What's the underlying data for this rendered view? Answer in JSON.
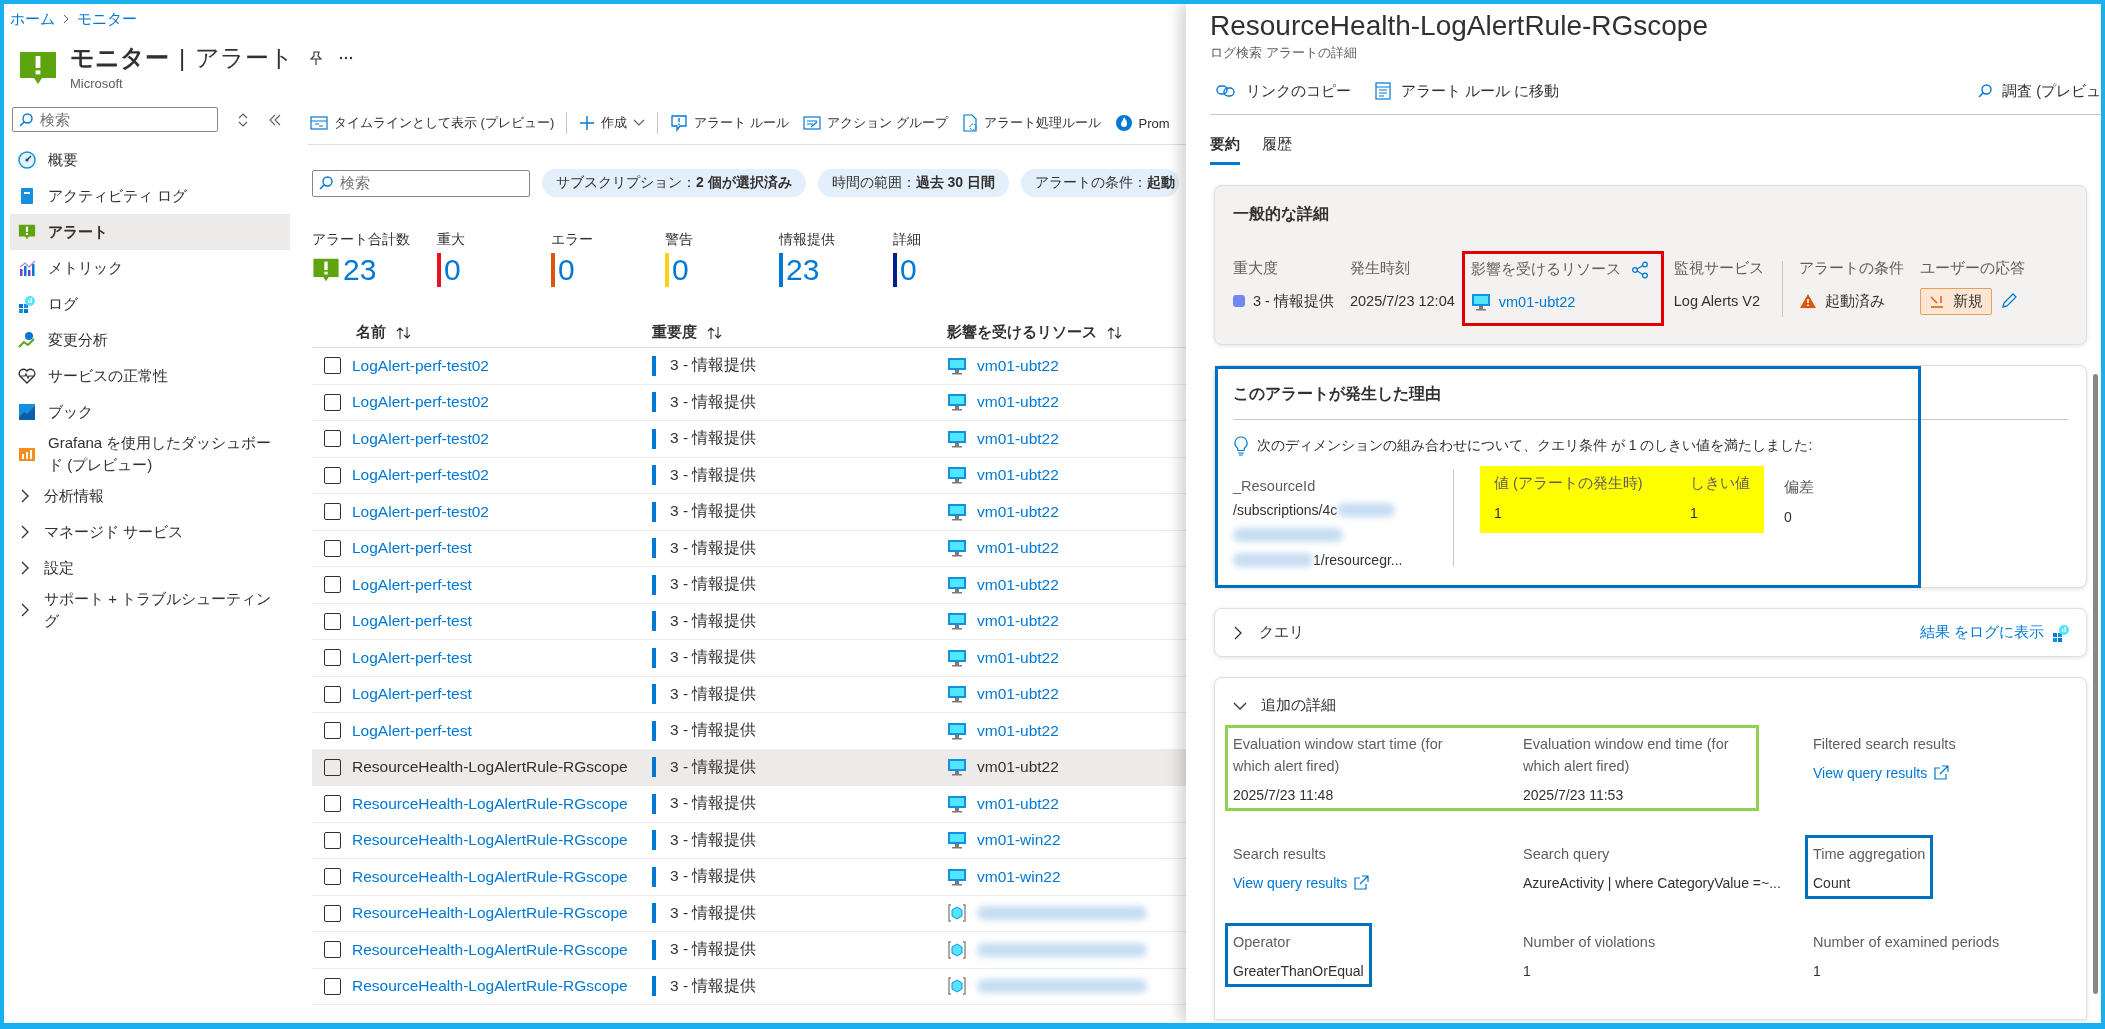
{
  "breadcrumb": [
    {
      "label": "ホーム"
    },
    {
      "label": "モニター"
    }
  ],
  "page": {
    "title": "モニター",
    "separator": "|",
    "section": "アラート",
    "subtitle": "Microsoft"
  },
  "sidebar": {
    "search": {
      "placeholder": "検索"
    },
    "items": [
      {
        "label": "概要",
        "kind": "link",
        "selected": false
      },
      {
        "label": "アクティビティ ログ",
        "kind": "link",
        "selected": false
      },
      {
        "label": "アラート",
        "kind": "link",
        "selected": true
      },
      {
        "label": "メトリック",
        "kind": "link",
        "selected": false
      },
      {
        "label": "ログ",
        "kind": "link",
        "selected": false
      },
      {
        "label": "変更分析",
        "kind": "link",
        "selected": false
      },
      {
        "label": "サービスの正常性",
        "kind": "link",
        "selected": false
      },
      {
        "label": "ブック",
        "kind": "link",
        "selected": false
      },
      {
        "label": "Grafana を使用したダッシュボード (プレビュー)",
        "kind": "link",
        "selected": false
      },
      {
        "label": "分析情報",
        "kind": "group",
        "selected": false,
        "expanded": false
      },
      {
        "label": "マネージド サービス",
        "kind": "group",
        "selected": false,
        "expanded": false
      },
      {
        "label": "設定",
        "kind": "group",
        "selected": false,
        "expanded": false
      },
      {
        "label": "サポート + トラブルシューティング",
        "kind": "group",
        "selected": false,
        "expanded": false
      }
    ]
  },
  "toolbar": [
    {
      "label": "タイムラインとして表示 (プレビュー)",
      "kind": "button"
    },
    {
      "label": "作成",
      "kind": "dropdown"
    },
    {
      "label": "アラート ルール",
      "kind": "button"
    },
    {
      "label": "アクション グループ",
      "kind": "button"
    },
    {
      "label": "アラート処理ルール",
      "kind": "button"
    },
    {
      "label": "Prom",
      "kind": "button"
    }
  ],
  "filters": {
    "search": {
      "placeholder": "検索"
    },
    "pills": [
      {
        "label": "サブスクリプション：**2 個が選択済み**"
      },
      {
        "label": "時間の範囲：**過去 30 日間**"
      },
      {
        "label": "アラートの条件：**起動**"
      }
    ]
  },
  "summary": [
    {
      "label": "アラート合計数",
      "count": "23",
      "kind": "total"
    },
    {
      "label": "重大",
      "count": "0",
      "kind": "severity",
      "color": "#e81123"
    },
    {
      "label": "エラー",
      "count": "0",
      "kind": "severity",
      "color": "#d9580f"
    },
    {
      "label": "警告",
      "count": "0",
      "kind": "severity",
      "color": "#fcd116"
    },
    {
      "label": "情報提供",
      "count": "23",
      "kind": "severity",
      "color": "#0078d4"
    },
    {
      "label": "詳細",
      "count": "0",
      "kind": "severity",
      "color": "#001e8c"
    }
  ],
  "table": {
    "columns": [
      {
        "label": "名前"
      },
      {
        "label": "重要度"
      },
      {
        "label": "影響を受けるリソース"
      }
    ],
    "rows": [
      {
        "name": "LogAlert-perf-test02",
        "severity": "3 - 情報提供",
        "resource": "vm01-ubt22",
        "selected": false
      },
      {
        "name": "LogAlert-perf-test02",
        "severity": "3 - 情報提供",
        "resource": "vm01-ubt22",
        "selected": false
      },
      {
        "name": "LogAlert-perf-test02",
        "severity": "3 - 情報提供",
        "resource": "vm01-ubt22",
        "selected": false
      },
      {
        "name": "LogAlert-perf-test02",
        "severity": "3 - 情報提供",
        "resource": "vm01-ubt22",
        "selected": false
      },
      {
        "name": "LogAlert-perf-test02",
        "severity": "3 - 情報提供",
        "resource": "vm01-ubt22",
        "selected": false
      },
      {
        "name": "LogAlert-perf-test",
        "severity": "3 - 情報提供",
        "resource": "vm01-ubt22",
        "selected": false
      },
      {
        "name": "LogAlert-perf-test",
        "severity": "3 - 情報提供",
        "resource": "vm01-ubt22",
        "selected": false
      },
      {
        "name": "LogAlert-perf-test",
        "severity": "3 - 情報提供",
        "resource": "vm01-ubt22",
        "selected": false
      },
      {
        "name": "LogAlert-perf-test",
        "severity": "3 - 情報提供",
        "resource": "vm01-ubt22",
        "selected": false
      },
      {
        "name": "LogAlert-perf-test",
        "severity": "3 - 情報提供",
        "resource": "vm01-ubt22",
        "selected": false
      },
      {
        "name": "LogAlert-perf-test",
        "severity": "3 - 情報提供",
        "resource": "vm01-ubt22",
        "selected": false
      },
      {
        "name": "ResourceHealth-LogAlertRule-RGscope",
        "severity": "3 - 情報提供",
        "resource": "vm01-ubt22",
        "selected": true
      },
      {
        "name": "ResourceHealth-LogAlertRule-RGscope",
        "severity": "3 - 情報提供",
        "resource": "vm01-ubt22",
        "selected": false
      },
      {
        "name": "ResourceHealth-LogAlertRule-RGscope",
        "severity": "3 - 情報提供",
        "resource": "vm01-win22",
        "selected": false
      },
      {
        "name": "ResourceHealth-LogAlertRule-RGscope",
        "severity": "3 - 情報提供",
        "resource": "vm01-win22",
        "selected": false
      },
      {
        "name": "ResourceHealth-LogAlertRule-RGscope",
        "severity": "3 - 情報提供",
        "selected": false
      },
      {
        "name": "ResourceHealth-LogAlertRule-RGscope",
        "severity": "3 - 情報提供",
        "selected": false
      },
      {
        "name": "ResourceHealth-LogAlertRule-RGscope",
        "severity": "3 - 情報提供",
        "selected": false
      }
    ]
  },
  "details": {
    "title": "ResourceHealth-LogAlertRule-RGscope",
    "subtitle": "ログ検索 アラートの詳細",
    "actions": [
      {
        "label": "リンクのコピー"
      },
      {
        "label": "アラート ルール に移動"
      },
      {
        "label": "調査 (プレビュ"
      }
    ],
    "tabs": [
      {
        "label": "要約",
        "selected": true
      },
      {
        "label": "履歴",
        "selected": false
      }
    ],
    "general": {
      "title": "一般的な詳細",
      "fields": [
        {
          "label": "重大度",
          "value": "3 - 情報提供",
          "kind": "severity"
        },
        {
          "label": "発生時刻",
          "value": "2025/7/23 12:04",
          "kind": "text"
        },
        {
          "label": "影響を受けるリソース",
          "value": "vm01-ubt22",
          "kind": "resource",
          "color": "#e00000"
        },
        {
          "label": "監視サービス",
          "value": "Log Alerts V2",
          "kind": "text"
        },
        {
          "label": "アラートの条件",
          "value": "起動済み",
          "kind": "condition"
        },
        {
          "label": "ユーザーの応答",
          "value": "新規",
          "kind": "response"
        }
      ]
    },
    "reason": {
      "title": "このアラートが発生した理由",
      "color": "#0070c0",
      "note": "次のディメンションの組み合わせについて、クエリ条件 が 1 のしきい値を満たしました:",
      "dimension": {
        "label": "_ResourceId",
        "lines": [
          {
            "text": "/subscriptions/4c",
            "kind": "blurtail"
          },
          {
            "kind": "blurfull"
          },
          {
            "text": "1/resourcegr...",
            "kind": "blurhead"
          }
        ]
      },
      "metrics": [
        {
          "label": "値 (アラートの発生時)",
          "value": "1",
          "color": "#ffff00"
        },
        {
          "label": "しきい値",
          "value": "1",
          "color": "#ffff00"
        },
        {
          "label": "偏差",
          "value": "0"
        }
      ]
    },
    "query": {
      "title": "クエリ",
      "expanded": false,
      "link": "結果 をログに表示"
    },
    "additional": {
      "title": "追加の詳細",
      "expanded": true,
      "fields": [
        {
          "label": "Evaluation window start time (for which alert fired)",
          "value": "2025/7/23 11:48",
          "kind": "text",
          "color": "#92d050"
        },
        {
          "label": "Evaluation window end time (for which alert fired)",
          "value": "2025/7/23 11:53",
          "kind": "text",
          "color": "#92d050"
        },
        {
          "label": "Filtered search results",
          "value": "View query results",
          "kind": "link"
        },
        {
          "label": "Search results",
          "value": "View query results",
          "kind": "link"
        },
        {
          "label": "Search query",
          "value": "AzureActivity | where CategoryValue =~...",
          "kind": "text"
        },
        {
          "label": "Time aggregation",
          "value": "Count",
          "kind": "text",
          "color": "#0070c0"
        },
        {
          "label": "Operator",
          "value": "GreaterThanOrEqual",
          "kind": "text",
          "color": "#0070c0"
        },
        {
          "label": "Number of violations",
          "value": "1",
          "kind": "text"
        },
        {
          "label": "Number of examined periods",
          "value": "1",
          "kind": "text"
        }
      ]
    }
  }
}
